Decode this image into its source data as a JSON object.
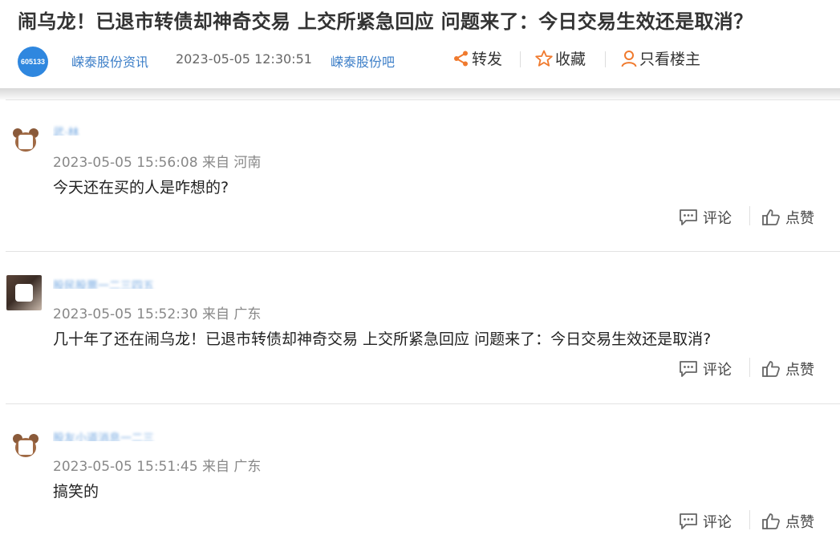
{
  "header": {
    "title": "闹乌龙！已退市转债却神奇交易 上交所紧急回应 问题来了：今日交易生效还是取消？",
    "logo_text": "605133",
    "author": "嵘泰股份资讯",
    "publish_time": "2023-05-05 12:30:51",
    "bar_name": "嵘泰股份吧",
    "actions": {
      "share": "转发",
      "favorite": "收藏",
      "author_only": "只看楼主"
    }
  },
  "colors": {
    "accent": "#2f87df",
    "link": "#3d7fc8",
    "action_icon": "#f07a2e"
  },
  "comments": [
    {
      "user": "武·林",
      "avatar": "bear-avatar",
      "time": "2023-05-05 15:56:08 来自 河南",
      "text": "今天还在买的人是咋想的?",
      "reply_label": "评论",
      "like_label": "点赞"
    },
    {
      "user": "股民股票一二三四五",
      "avatar": "photo-avatar",
      "time": "2023-05-05 15:52:30 来自 广东",
      "text": "几十年了还在闹乌龙！已退市转债却神奇交易 上交所紧急回应 问题来了：今日交易生效还是取消?",
      "reply_label": "评论",
      "like_label": "点赞"
    },
    {
      "user": "股友小道消息一二三",
      "avatar": "bear-avatar",
      "time": "2023-05-05 15:51:45 来自 广东",
      "text": "搞笑的",
      "reply_label": "评论",
      "like_label": "点赞"
    }
  ]
}
